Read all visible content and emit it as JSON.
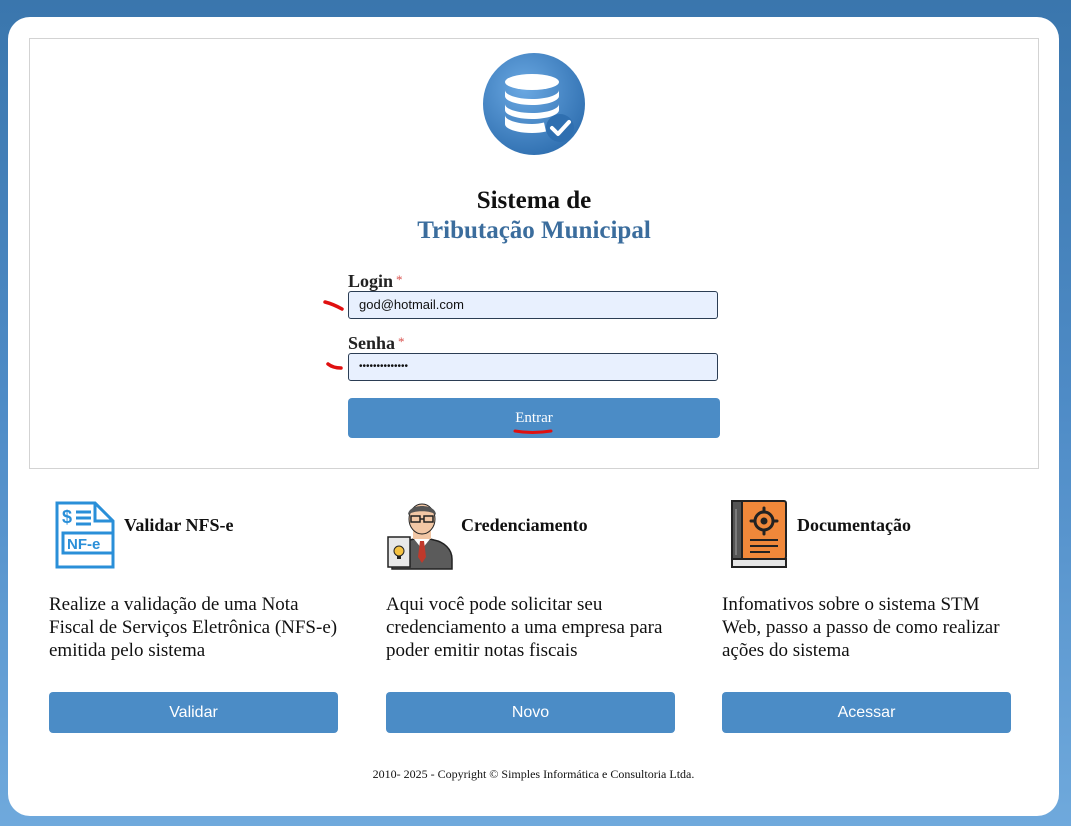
{
  "app": {
    "title_line1": "Sistema de",
    "title_line2": "Tributação Municipal",
    "logo_icon": "database-check-icon"
  },
  "login_form": {
    "login_label": "Login",
    "login_required": "*",
    "login_value": "god@hotmail.com",
    "password_label": "Senha",
    "password_required": "*",
    "password_value": "••••••••••••••",
    "submit_label": "Entrar"
  },
  "features": [
    {
      "icon": "nfse-document-icon",
      "heading": "Validar NFS-e",
      "description": "Realize a validação de uma Nota Fiscal de Serviços Eletrônica (NFS-e) emitida pelo sistema",
      "button_label": "Validar"
    },
    {
      "icon": "businessman-icon",
      "heading": "Credenciamento",
      "description": "Aqui você pode solicitar seu credenciamento a uma empresa para poder emitir notas fiscais",
      "button_label": "Novo"
    },
    {
      "icon": "manual-book-gear-icon",
      "heading": "Documentação",
      "description": "Infomativos sobre o sistema STM Web, passo a passo de como realizar ações do sistema",
      "button_label": "Acessar"
    }
  ],
  "footer": {
    "copyright": "2010- 2025 - Copyright © Simples Informática e Consultoria Ltda."
  },
  "colors": {
    "accent": "#4b8cc6",
    "title_blue": "#3b6d9d",
    "input_bg": "#e8f0fe",
    "annotation_red": "#e01010"
  }
}
